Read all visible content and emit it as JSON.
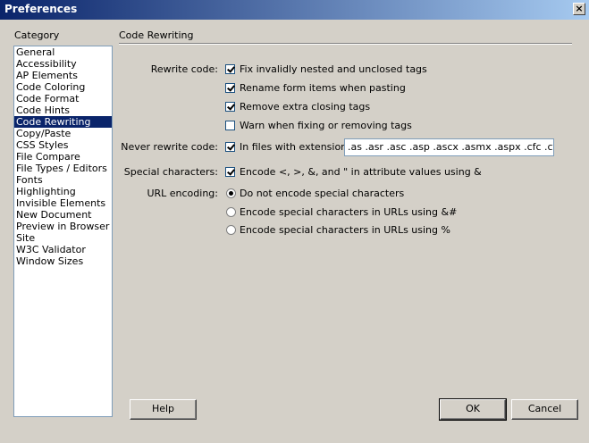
{
  "window": {
    "title": "Preferences",
    "close_glyph": "×"
  },
  "category": {
    "heading": "Category",
    "items": [
      "General",
      "Accessibility",
      "AP Elements",
      "Code Coloring",
      "Code Format",
      "Code Hints",
      "Code Rewriting",
      "Copy/Paste",
      "CSS Styles",
      "File Compare",
      "File Types / Editors",
      "Fonts",
      "Highlighting",
      "Invisible Elements",
      "New Document",
      "Preview in Browser",
      "Site",
      "W3C Validator",
      "Window Sizes"
    ],
    "selected": "Code Rewriting"
  },
  "panel": {
    "title": "Code Rewriting",
    "rewrite_code": {
      "label": "Rewrite code:",
      "options": [
        {
          "text": "Fix invalidly nested and unclosed tags",
          "checked": true
        },
        {
          "text": "Rename form items when pasting",
          "checked": true
        },
        {
          "text": "Remove extra closing tags",
          "checked": true
        },
        {
          "text": "Warn when fixing or removing tags",
          "checked": false
        }
      ]
    },
    "never_rewrite": {
      "label": "Never rewrite code:",
      "option_text": "In files with extensions",
      "checked": true,
      "extensions_value": ".as .asr .asc .asp .ascx .asmx .aspx .cfc .cfm ."
    },
    "special_chars": {
      "label": "Special characters:",
      "option_text": "Encode <, >, &, and \" in attribute values using &",
      "checked": true
    },
    "url_encoding": {
      "label": "URL encoding:",
      "options": [
        {
          "text": "Do not encode special characters",
          "selected": true
        },
        {
          "text": "Encode special characters in URLs using &#",
          "selected": false
        },
        {
          "text": "Encode special characters in URLs using %",
          "selected": false
        }
      ]
    }
  },
  "buttons": {
    "help": "Help",
    "ok": "OK",
    "cancel": "Cancel"
  }
}
